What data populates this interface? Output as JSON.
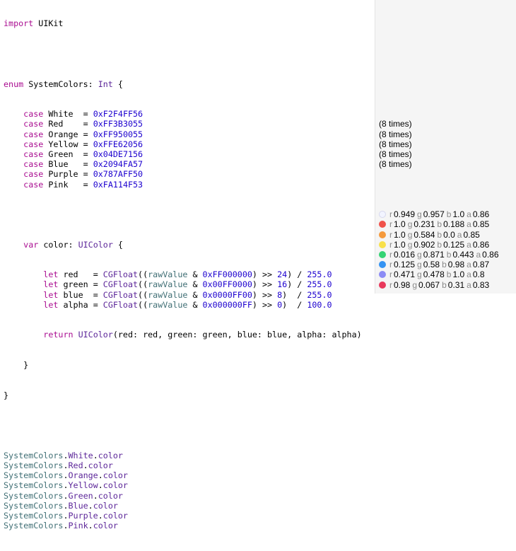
{
  "code": {
    "import_kw": "import",
    "import_mod": "UIKit",
    "enum_kw": "enum",
    "enum_name": "SystemColors:",
    "enum_type": "Int",
    "brace_open": "{",
    "cases": [
      {
        "kw": "case",
        "name": "White ",
        "hex": "0xF2F4FF56"
      },
      {
        "kw": "case",
        "name": "Red   ",
        "hex": "0xFF3B3055"
      },
      {
        "kw": "case",
        "name": "Orange",
        "hex": "0xFF950055"
      },
      {
        "kw": "case",
        "name": "Yellow",
        "hex": "0xFFE62056"
      },
      {
        "kw": "case",
        "name": "Green ",
        "hex": "0x04DE7156"
      },
      {
        "kw": "case",
        "name": "Blue  ",
        "hex": "0x2094FA57"
      },
      {
        "kw": "case",
        "name": "Purple",
        "hex": "0x787AFF50"
      },
      {
        "kw": "case",
        "name": "Pink  ",
        "hex": "0xFA114F53"
      }
    ],
    "var_kw": "var",
    "var_name": "color:",
    "var_type": "UIColor",
    "lets": [
      {
        "kw": "let",
        "name": "red  ",
        "cgf": "CGFloat",
        "raw": "rawValue",
        "mask": "0xFF000000",
        "shift": "24",
        "div": "255.0"
      },
      {
        "kw": "let",
        "name": "green",
        "cgf": "CGFloat",
        "raw": "rawValue",
        "mask": "0x00FF0000",
        "shift": "16",
        "div": "255.0"
      },
      {
        "kw": "let",
        "name": "blue ",
        "cgf": "CGFloat",
        "raw": "rawValue",
        "mask": "0x0000FF00",
        "shift": "8",
        "div": "255.0"
      },
      {
        "kw": "let",
        "name": "alpha",
        "cgf": "CGFloat",
        "raw": "rawValue",
        "mask": "0x000000FF",
        "shift": "0",
        "div": "100.0"
      }
    ],
    "return_kw": "return",
    "return_type": "UIColor",
    "return_args": "(red: red, green: green, blue: blue, alpha: alpha)",
    "close_brace": "}",
    "usages": [
      {
        "enum": "SystemColors",
        "member": "White",
        "prop": "color"
      },
      {
        "enum": "SystemColors",
        "member": "Red",
        "prop": "color"
      },
      {
        "enum": "SystemColors",
        "member": "Orange",
        "prop": "color"
      },
      {
        "enum": "SystemColors",
        "member": "Yellow",
        "prop": "color"
      },
      {
        "enum": "SystemColors",
        "member": "Green",
        "prop": "color"
      },
      {
        "enum": "SystemColors",
        "member": "Blue",
        "prop": "color"
      },
      {
        "enum": "SystemColors",
        "member": "Purple",
        "prop": "color"
      },
      {
        "enum": "SystemColors",
        "member": "Pink",
        "prop": "color"
      }
    ]
  },
  "results": {
    "times": [
      "(8 times)",
      "(8 times)",
      "(8 times)",
      "(8 times)",
      "(8 times)"
    ],
    "colors": [
      {
        "swatch": "#f2f4ff",
        "swatch_border": "#d6d8ee",
        "r": "0.949",
        "g": "0.957",
        "b": "1.0",
        "a": "0.86"
      },
      {
        "swatch": "#f0524a",
        "swatch_border": "#f0524a",
        "r": "1.0",
        "g": "0.231",
        "b": "0.188",
        "a": "0.85"
      },
      {
        "swatch": "#f59a3c",
        "swatch_border": "#f59a3c",
        "r": "1.0",
        "g": "0.584",
        "b": "0.0",
        "a": "0.85"
      },
      {
        "swatch": "#f8e04a",
        "swatch_border": "#f8e04a",
        "r": "1.0",
        "g": "0.902",
        "b": "0.125",
        "a": "0.86"
      },
      {
        "swatch": "#34d374",
        "swatch_border": "#34d374",
        "r": "0.016",
        "g": "0.871",
        "b": "0.443",
        "a": "0.86"
      },
      {
        "swatch": "#3593f2",
        "swatch_border": "#3593f2",
        "r": "0.125",
        "g": "0.58",
        "b": "0.98",
        "a": "0.87"
      },
      {
        "swatch": "#8c8cf5",
        "swatch_border": "#8c8cf5",
        "r": "0.471",
        "g": "0.478",
        "b": "1.0",
        "a": "0.8"
      },
      {
        "swatch": "#e8395c",
        "swatch_border": "#e8395c",
        "r": "0.98",
        "g": "0.067",
        "b": "0.31",
        "a": "0.83"
      }
    ],
    "labels": {
      "r": "r",
      "g": "g",
      "b": "b",
      "a": "a"
    }
  }
}
